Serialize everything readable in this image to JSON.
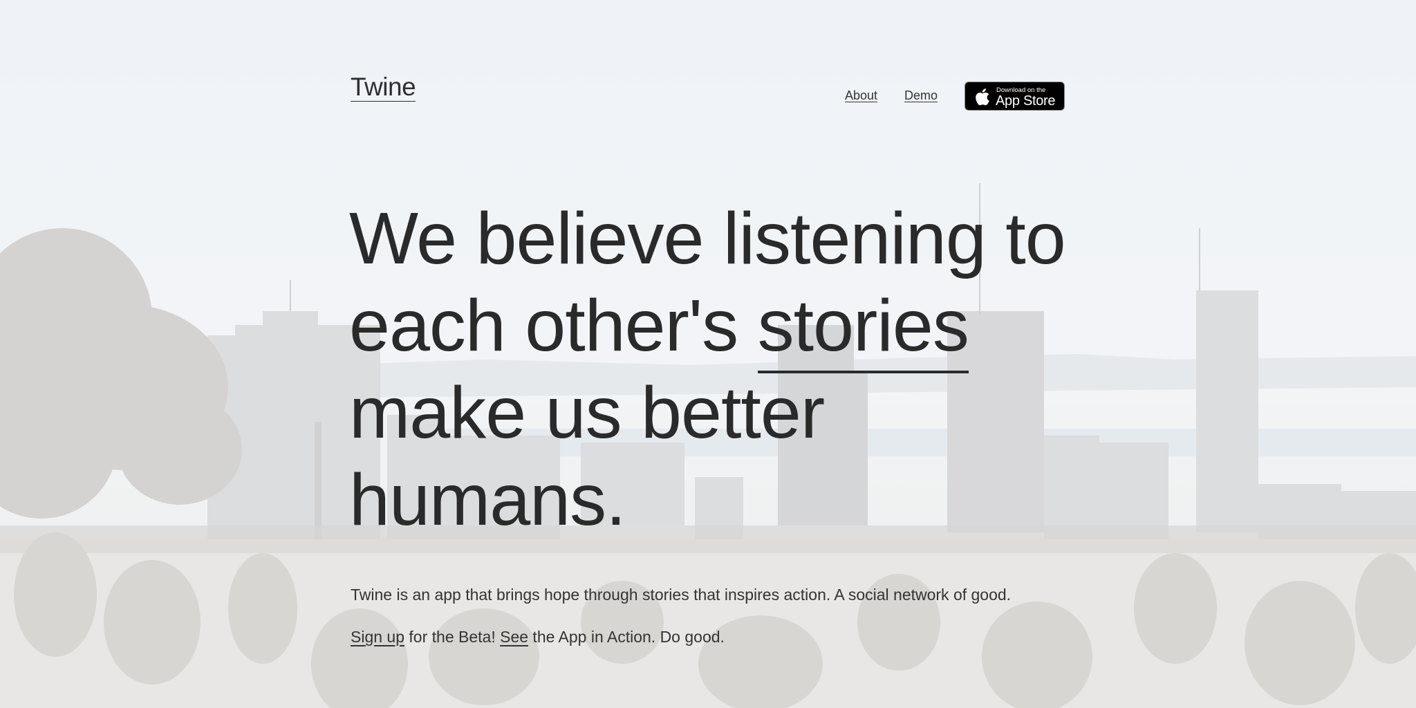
{
  "header": {
    "brand": "Twine",
    "nav": {
      "about": "About",
      "demo": "Demo"
    },
    "app_store_badge": {
      "small_text": "Download on the",
      "big_text": "App Store",
      "icon": "apple-icon"
    }
  },
  "hero": {
    "headline_before": "We believe listening to each other's ",
    "headline_link": "stories",
    "headline_after": " make us better humans.",
    "tagline": "Twine is an app that brings hope through stories that inspires action. A social network of good.",
    "cta": {
      "signup_link": "Sign up",
      "text_1": " for the Beta! ",
      "see_link": "See",
      "text_2": " the App in Action. Do good."
    }
  },
  "colors": {
    "text": "#2f2f2f",
    "badge_bg": "#000000",
    "badge_text": "#ffffff"
  }
}
